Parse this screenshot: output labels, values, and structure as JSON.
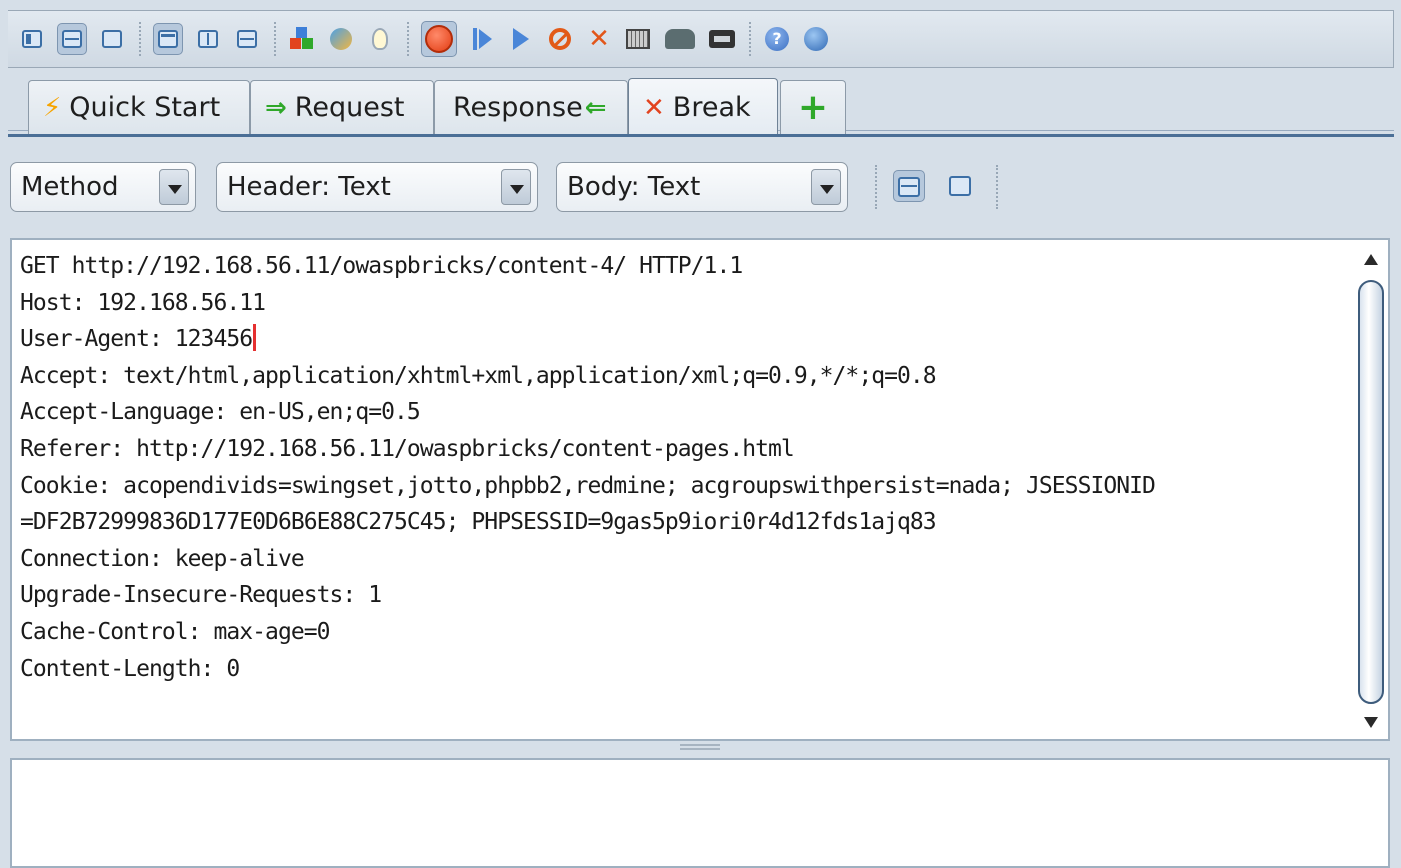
{
  "toolbar": {
    "icons": [
      "pane-list-icon",
      "pane-split-horizontal-icon",
      "pane-single-icon",
      "pane-top-icon",
      "pane-split-vertical-icon",
      "pane-rows-icon",
      "add-on-puzzle-icon",
      "refresh-icon",
      "tip-bulb-icon",
      "stop-record-icon",
      "step-icon",
      "continue-icon",
      "drop-icon",
      "new-break-icon",
      "grid-icon",
      "elephant-icon",
      "tape-icon",
      "help-icon",
      "globe-icon"
    ]
  },
  "tabs": [
    {
      "icon": "⚡",
      "label": "Quick Start"
    },
    {
      "icon": "⇒",
      "label": "Request"
    },
    {
      "icon": "⇐",
      "label": "Response"
    },
    {
      "icon": "✕",
      "label": "Break"
    },
    {
      "icon": "+",
      "label": ""
    }
  ],
  "view_options": {
    "method_select": "Method",
    "header_select": "Header: Text",
    "body_select": "Body: Text"
  },
  "request": {
    "lines_before_caret": "GET http://192.168.56.11/owaspbricks/content-4/ HTTP/1.1\nHost: 192.168.56.11\nUser-Agent: 123456",
    "lines_after_caret": "\nAccept: text/html,application/xhtml+xml,application/xml;q=0.9,*/*;q=0.8\nAccept-Language: en-US,en;q=0.5\nReferer: http://192.168.56.11/owaspbricks/content-pages.html\nCookie: acopendivids=swingset,jotto,phpbb2,redmine; acgroupswithpersist=nada; JSESSIONID\n=DF2B72999836D177E0D6B6E88C275C45; PHPSESSID=9gas5p9iori0r4d12fds1ajq83\nConnection: keep-alive\nUpgrade-Insecure-Requests: 1\nCache-Control: max-age=0\nContent-Length: 0"
  },
  "colors": {
    "caret": "#e53030",
    "background": "#d6dfe8",
    "tab_underline": "#4b6f96"
  }
}
